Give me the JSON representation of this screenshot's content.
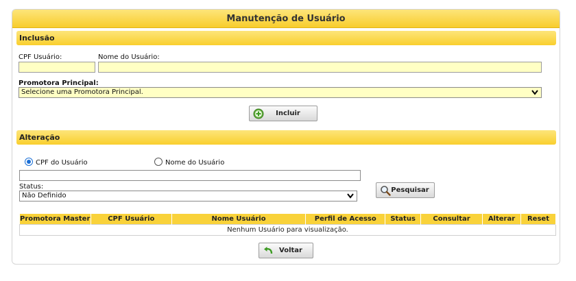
{
  "title": "Manutenção de Usuário",
  "inclusao": {
    "section_title": "Inclusão",
    "cpf_label": "CPF Usuário:",
    "cpf_value": "",
    "nome_label": "Nome do Usuário:",
    "nome_value": "",
    "promotora_label": "Promotora Principal:",
    "promotora_selected": "Selecione uma Promotora Principal.",
    "incluir_button": "Incluir"
  },
  "alteracao": {
    "section_title": "Alteração",
    "radio_cpf_label": "CPF do Usuário",
    "radio_nome_label": "Nome do Usuário",
    "radio_selected": "CPF do Usuário",
    "search_value": "",
    "status_label": "Status:",
    "status_selected": "Não Definido",
    "pesquisar_button": "Pesquisar"
  },
  "table": {
    "columns": [
      "Promotora Master",
      "CPF Usuário",
      "Nome Usuário",
      "Perfil de Acesso",
      "Status",
      "Consultar",
      "Alterar",
      "Reset"
    ],
    "empty_message": "Nenhum Usuário para visualização."
  },
  "voltar_button": "Voltar",
  "colors": {
    "header_yellow": "#f9d23a",
    "field_yellow": "#ffffc4",
    "radio_blue": "#1a6fd6"
  },
  "icons": {
    "incluir": "add-icon",
    "pesquisar": "magnifier-icon",
    "voltar": "back-arrow-icon"
  }
}
